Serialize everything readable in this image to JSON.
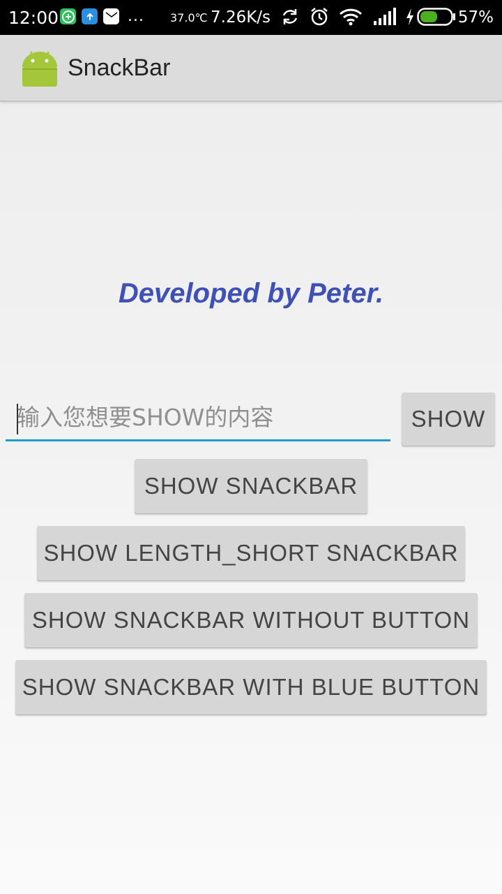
{
  "status_bar": {
    "time": "12:00",
    "temperature": "37.0℃",
    "net_speed": "7.26K/s",
    "battery_percent": "57%",
    "battery_level": 0.57,
    "more_indicator": "...",
    "icons": [
      "app-add-icon",
      "upload-icon",
      "mail-icon",
      "sync-icon",
      "alarm-icon",
      "wifi-icon",
      "signal-icon",
      "charging-icon",
      "battery-icon"
    ]
  },
  "action_bar": {
    "title": "SnackBar",
    "icon": "android-icon"
  },
  "main": {
    "developer_text": "Developed by Peter.",
    "input": {
      "placeholder": "输入您想要SHOW的内容",
      "value": ""
    },
    "show_button": "SHOW",
    "buttons": [
      "SHOW SNACKBAR",
      "SHOW LENGTH_SHORT SNACKBAR",
      "SHOW SNACKBAR WITHOUT BUTTON",
      "SHOW SNACKBAR WITH BLUE BUTTON"
    ]
  },
  "colors": {
    "accent": "#3f51b5",
    "input_underline": "#1e9ccb",
    "button_bg": "#d6d6d6",
    "android_green": "#a4c639",
    "battery_green": "#4caf1f"
  }
}
